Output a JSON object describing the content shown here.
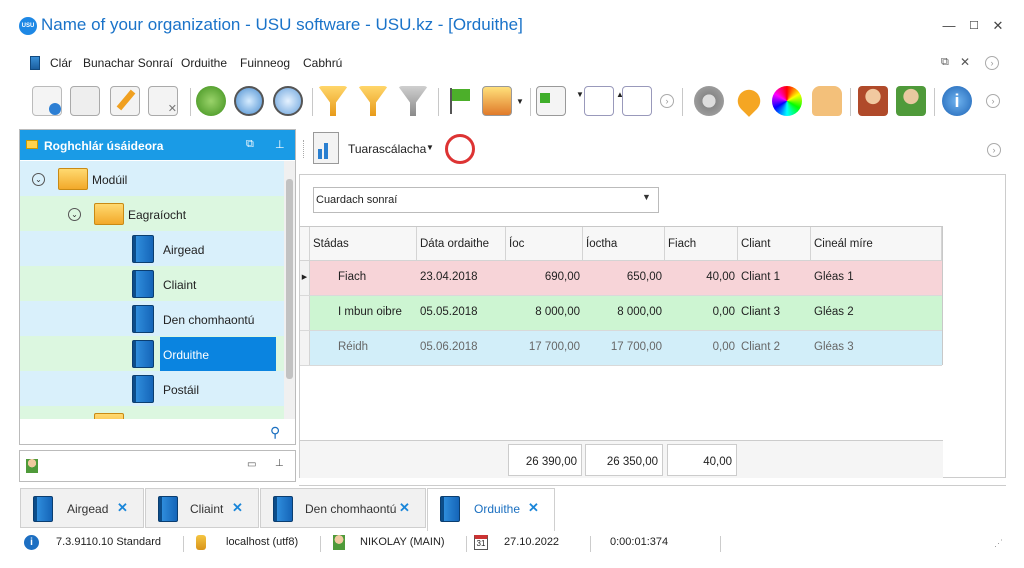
{
  "window": {
    "title": "Name of your organization - USU software - USU.kz - [Orduithe]",
    "icon_text": "USU"
  },
  "menu": {
    "items": [
      "Clár",
      "Bunachar Sonraí",
      "Orduithe",
      "Fuinneog",
      "Cabhrú"
    ]
  },
  "toolbar_icons": [
    "new-icon",
    "copy-icon",
    "edit-icon",
    "delete-icon",
    "refresh-icon",
    "search-icon",
    "advanced-search-icon",
    "filter-icon",
    "filter-column-icon",
    "filter-apply-icon",
    "flag-icon",
    "image-icon",
    "add-row-icon",
    "tree-expand-icon",
    "tree-collapse-icon",
    "settings-icon",
    "map-pin-icon",
    "color-wheel-icon",
    "hand-icon",
    "user-icon",
    "users-icon",
    "info-icon"
  ],
  "left_panel": {
    "title": "Roghchlár úsáideora",
    "tree": [
      {
        "label": "Modúil",
        "type": "folder"
      },
      {
        "label": "Eagraíocht",
        "type": "folder"
      },
      {
        "label": "Airgead",
        "type": "book"
      },
      {
        "label": "Cliaint",
        "type": "book"
      },
      {
        "label": "Den chomhaontú",
        "type": "book"
      },
      {
        "label": "Orduithe",
        "type": "book",
        "selected": true
      },
      {
        "label": "Postáil",
        "type": "book"
      }
    ]
  },
  "reports": {
    "label": "Tuarascálacha"
  },
  "search": {
    "placeholder": "Cuardach sonraí"
  },
  "grid": {
    "columns": [
      "Stádas",
      "Dáta ordaithe",
      "Íoc",
      "Íoctha",
      "Fiach",
      "Cliant",
      "Cineál míre"
    ],
    "rows": [
      {
        "status": "Fiach",
        "date": "23.04.2018",
        "pay": "690,00",
        "paid": "650,00",
        "debt": "40,00",
        "client": "Cliant 1",
        "type": "Gléas 1",
        "color": "#f7d4d8"
      },
      {
        "status": "I mbun oibre",
        "date": "05.05.2018",
        "pay": "8 000,00",
        "paid": "8 000,00",
        "debt": "0,00",
        "client": "Cliant 3",
        "type": "Gléas 2",
        "color": "#cdf5d2"
      },
      {
        "status": "Réidh",
        "date": "05.06.2018",
        "pay": "17 700,00",
        "paid": "17 700,00",
        "debt": "0,00",
        "client": "Cliant 2",
        "type": "Gléas 3",
        "color": "#d2eef9"
      }
    ],
    "totals": {
      "pay": "26 390,00",
      "paid": "26 350,00",
      "debt": "40,00"
    }
  },
  "tabs": [
    {
      "label": "Airgead",
      "active": false
    },
    {
      "label": "Cliaint",
      "active": false
    },
    {
      "label": "Den chomhaontú",
      "active": false
    },
    {
      "label": "Orduithe",
      "active": true
    }
  ],
  "status": {
    "version": "7.3.9110.10 Standard",
    "db": "localhost (utf8)",
    "user": "NIKOLAY (MAIN)",
    "date": "27.10.2022",
    "timer": "0:00:01:374",
    "calendar_day": "31"
  },
  "colors": {
    "accent": "#1a9be6",
    "selected": "#0a84e0",
    "title": "#1a73c9"
  }
}
